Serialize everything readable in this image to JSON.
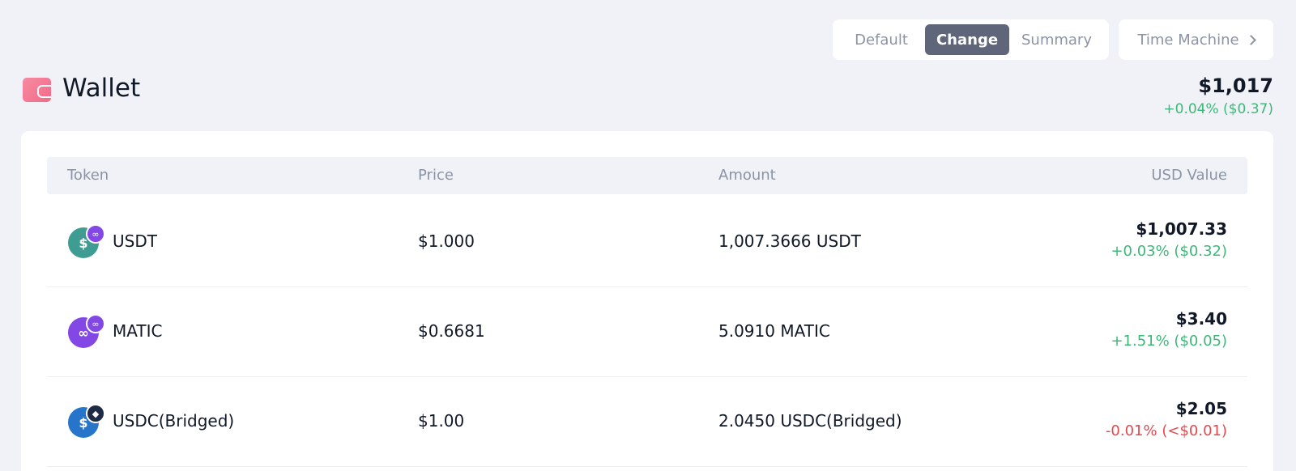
{
  "view_toggle": {
    "options": [
      "Default",
      "Change",
      "Summary"
    ],
    "selected": "Change"
  },
  "time_machine_label": "Time Machine",
  "wallet": {
    "title": "Wallet",
    "total": "$1,017",
    "total_change": "+0.04% ($0.37)"
  },
  "table": {
    "headers": {
      "token": "Token",
      "price": "Price",
      "amount": "Amount",
      "usd_value": "USD Value"
    },
    "rows": [
      {
        "token": "USDT",
        "price": "$1.000",
        "amount": "1,007.3666 USDT",
        "usd_value": "$1,007.33",
        "change": "+0.03% ($0.32)",
        "change_direction": "positive",
        "icon": "usdt-icon",
        "badge_icon": "polygon-icon"
      },
      {
        "token": "MATIC",
        "price": "$0.6681",
        "amount": "5.0910 MATIC",
        "usd_value": "$3.40",
        "change": "+1.51% ($0.05)",
        "change_direction": "positive",
        "icon": "matic-icon",
        "badge_icon": "polygon-icon"
      },
      {
        "token": "USDC(Bridged)",
        "price": "$1.00",
        "amount": "2.0450 USDC(Bridged)",
        "usd_value": "$2.05",
        "change": "-0.01% (<$0.01)",
        "change_direction": "negative",
        "icon": "usdc-icon",
        "badge_icon": "bridge-icon"
      }
    ]
  },
  "colors": {
    "positive": "#3db878",
    "negative": "#e5484d",
    "selected_toggle": "#5f667a",
    "background": "#f0f2f7"
  }
}
